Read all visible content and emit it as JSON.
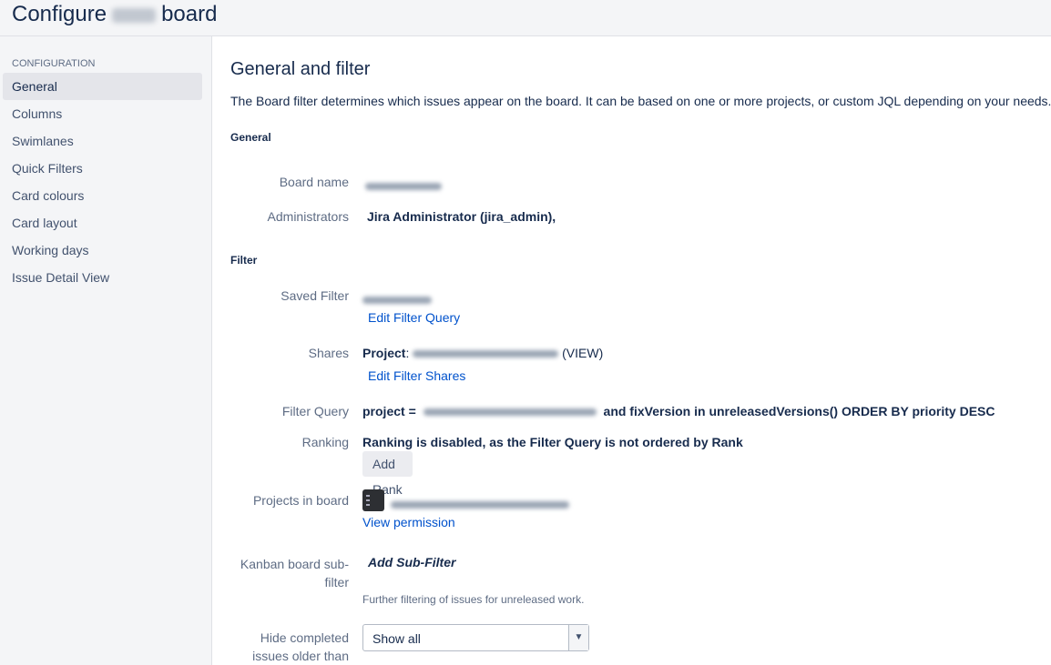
{
  "header": {
    "title_start": "Configure",
    "title_end": "board"
  },
  "sidebar": {
    "heading": "CONFIGURATION",
    "items": [
      {
        "label": "General",
        "active": true
      },
      {
        "label": "Columns"
      },
      {
        "label": "Swimlanes"
      },
      {
        "label": "Quick Filters"
      },
      {
        "label": "Card colours"
      },
      {
        "label": "Card layout"
      },
      {
        "label": "Working days"
      },
      {
        "label": "Issue Detail View"
      }
    ]
  },
  "main": {
    "title": "General and filter",
    "description": "The Board filter determines which issues appear on the board. It can be based on one or more projects, or custom JQL depending on your needs.",
    "general_section": "General",
    "board_name_label": "Board name",
    "administrators_label": "Administrators",
    "administrators_value": "Jira Administrator (jira_admin),",
    "filter_section": "Filter",
    "saved_filter_label": "Saved Filter",
    "edit_filter_query": "Edit Filter Query",
    "shares_label": "Shares",
    "shares_project_prefix": "Project",
    "shares_suffix": "(VIEW)",
    "edit_filter_shares": "Edit Filter Shares",
    "filter_query_label": "Filter Query",
    "filter_query_prefix": "project =",
    "filter_query_suffix": "and fixVersion in unreleasedVersions() ORDER BY priority DESC",
    "ranking_label": "Ranking",
    "ranking_value": "Ranking is disabled, as the Filter Query is not ordered by Rank",
    "add_rank_button": "Add Rank",
    "projects_label": "Projects in board",
    "view_permission": "View permission",
    "subfilter_label_line1": "Kanban board sub-",
    "subfilter_label_line2": "filter",
    "add_subfilter": "Add Sub-Filter",
    "subfilter_note": "Further filtering of issues for unreleased work.",
    "hide_completed_line1": "Hide completed",
    "hide_completed_line2": "issues older than",
    "hide_completed_value": "Show all"
  }
}
